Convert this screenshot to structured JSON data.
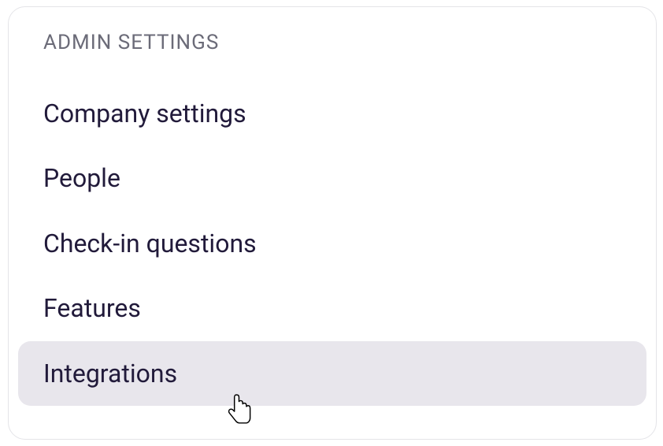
{
  "section": {
    "title": "ADMIN SETTINGS"
  },
  "menu": {
    "items": [
      {
        "label": "Company settings",
        "active": false
      },
      {
        "label": "People",
        "active": false
      },
      {
        "label": "Check-in questions",
        "active": false
      },
      {
        "label": "Features",
        "active": false
      },
      {
        "label": "Integrations",
        "active": true
      }
    ]
  }
}
